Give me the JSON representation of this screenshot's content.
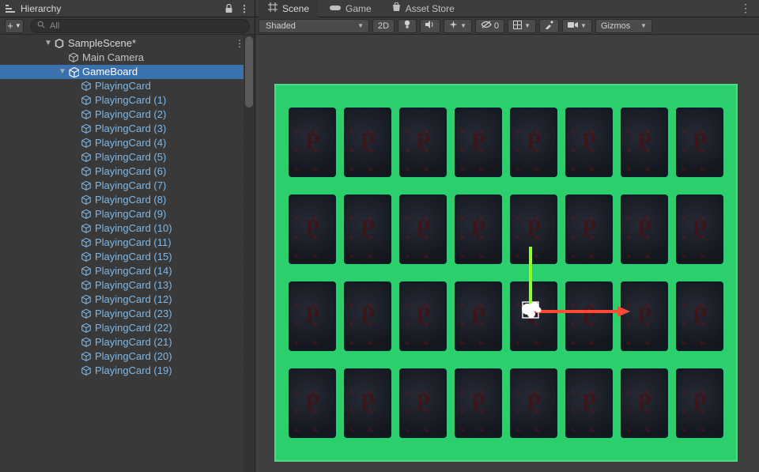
{
  "hierarchy": {
    "title": "Hierarchy",
    "add_icon": "+",
    "search_placeholder": "All",
    "scene": "SampleScene*",
    "main_camera": "Main Camera",
    "gameboard": "GameBoard",
    "children": [
      "PlayingCard",
      "PlayingCard (1)",
      "PlayingCard (2)",
      "PlayingCard (3)",
      "PlayingCard (4)",
      "PlayingCard (5)",
      "PlayingCard (6)",
      "PlayingCard (7)",
      "PlayingCard (8)",
      "PlayingCard (9)",
      "PlayingCard (10)",
      "PlayingCard (11)",
      "PlayingCard (15)",
      "PlayingCard (14)",
      "PlayingCard (13)",
      "PlayingCard (12)",
      "PlayingCard (23)",
      "PlayingCard (22)",
      "PlayingCard (21)",
      "PlayingCard (20)",
      "PlayingCard (19)"
    ]
  },
  "scene_tabs": {
    "scene": "Scene",
    "game": "Game",
    "asset_store": "Asset Store"
  },
  "toolbar": {
    "shaded": "Shaded",
    "mode_2d": "2D",
    "hidden_count": "0",
    "gizmos": "Gizmos"
  },
  "colors": {
    "selection": "#3a72b0",
    "prefab": "#7db8e8",
    "board": "#2bd06c",
    "axis_x": "#ff4b33",
    "axis_y": "#8fff2b"
  }
}
